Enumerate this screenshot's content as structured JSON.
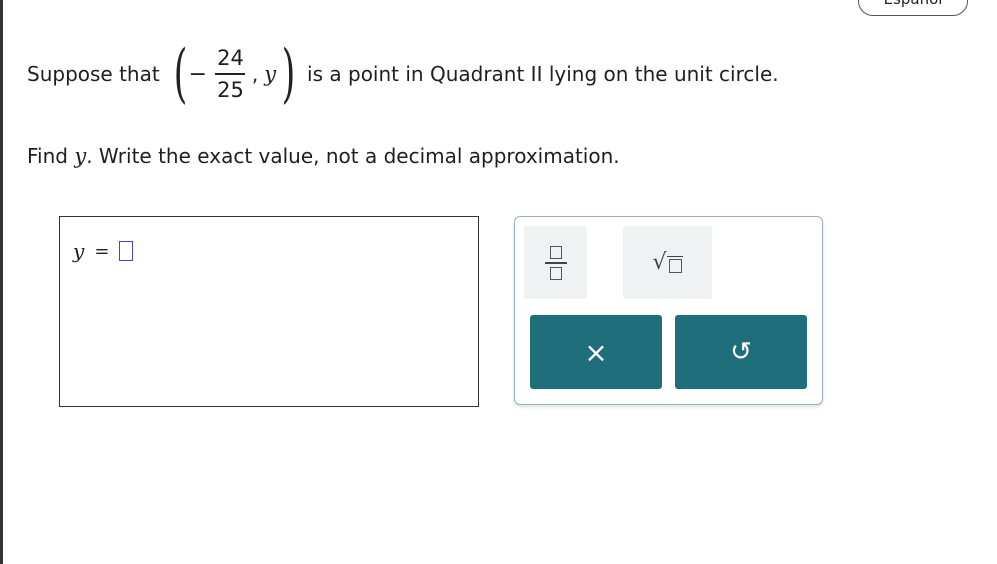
{
  "language_button": {
    "label": "Español"
  },
  "question": {
    "intro": "Suppose that",
    "point": {
      "sign": "−",
      "numerator": "24",
      "denominator": "25",
      "y": "y"
    },
    "tail": "is a point in Quadrant II lying on the unit circle.",
    "prompt_before": "Find",
    "prompt_var": "y",
    "prompt_after": ". Write the exact value, not a decimal approximation."
  },
  "answer": {
    "variable": "y",
    "equals": "="
  },
  "keypad": {
    "icons": {
      "fraction": "fraction-icon",
      "sqrt": "square-root-icon",
      "clear": "close-icon",
      "undo": "undo-icon"
    },
    "clear_symbol": "×",
    "undo_symbol": "↺"
  },
  "colors": {
    "action_button": "#1f6e7c",
    "slot_border": "#4b3fd8",
    "keypad_border": "#9bb0bd"
  }
}
